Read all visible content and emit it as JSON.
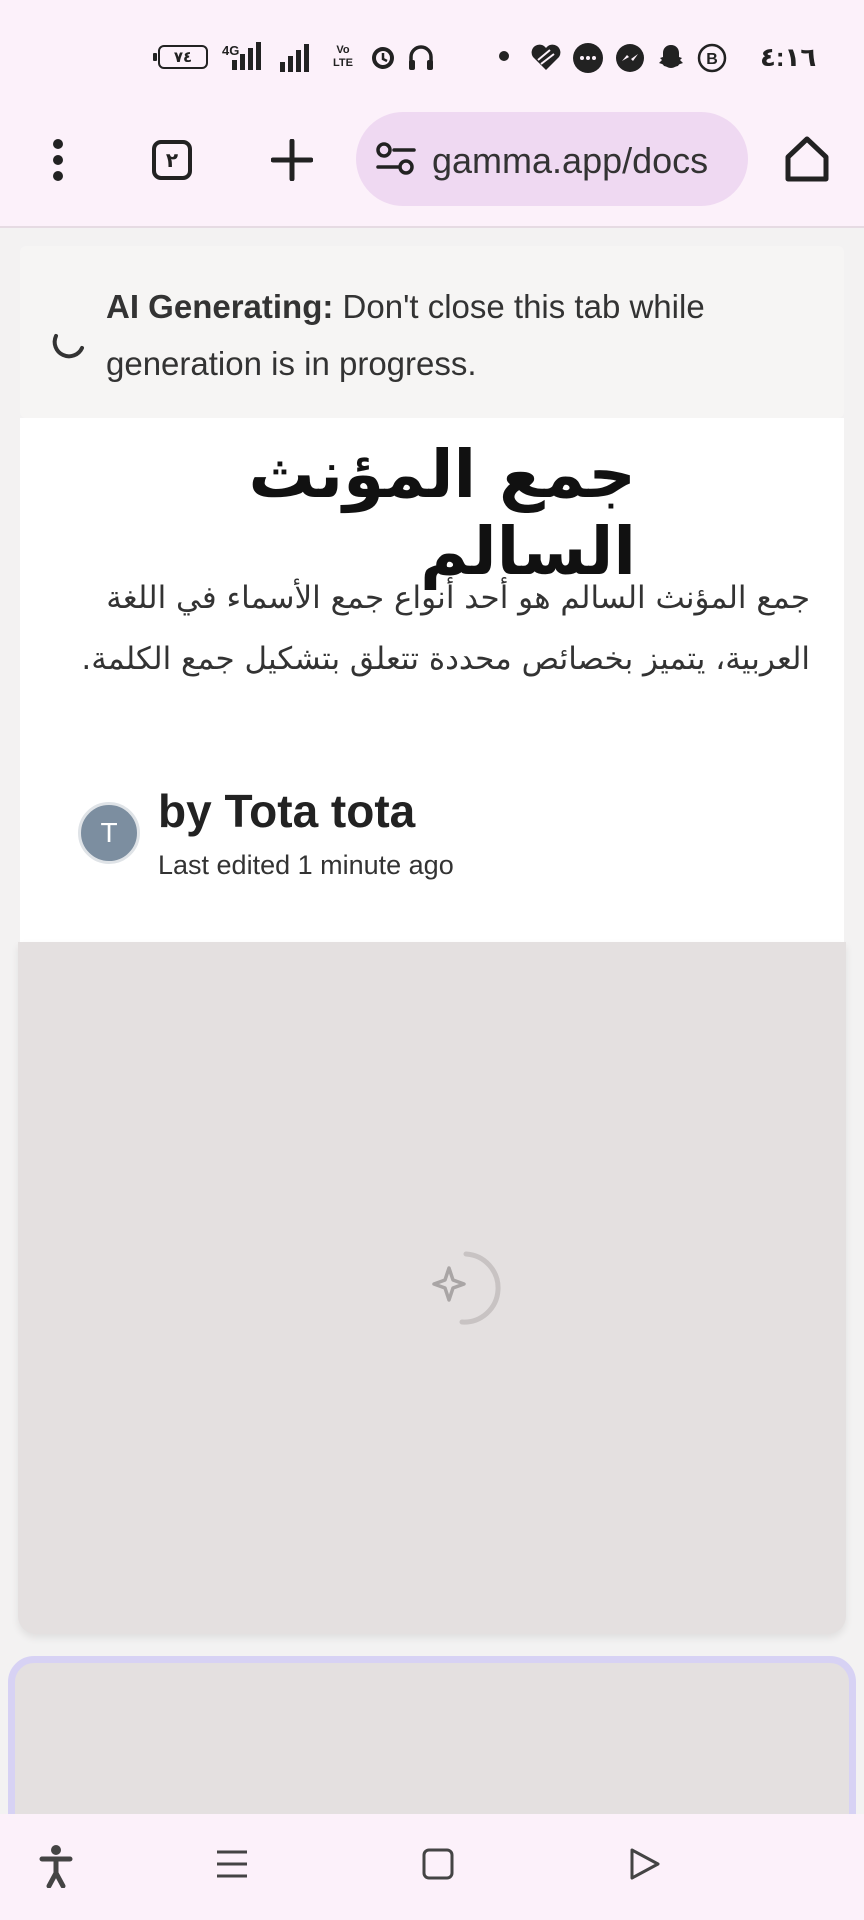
{
  "status_bar": {
    "battery": "٧٤",
    "network": "4G",
    "volte": "Vo LTE",
    "time": "٤:١٦",
    "icons": [
      "battery-icon",
      "signal-icon",
      "signal-icon",
      "volte-icon",
      "alarm-icon",
      "headphones-icon",
      "dot-icon",
      "heart-app-icon",
      "chat-icon",
      "messenger-icon",
      "snapchat-icon",
      "b-app-icon"
    ]
  },
  "toolbar": {
    "tab_count": "٢",
    "url": "gamma.app/docs",
    "icons": [
      "more-vert-icon",
      "tab-switcher-icon",
      "new-tab-icon",
      "site-settings-icon",
      "home-icon"
    ]
  },
  "banner": {
    "label": "AI Generating:",
    "message": " Don't close this tab while generation is in progress."
  },
  "doc": {
    "title": "جمع المؤنث السالم",
    "description": "جمع المؤنث السالم هو أحد أنواع جمع الأسماء في اللغة العربية، يتميز بخصائص محددة تتعلق بتشكيل جمع الكلمة.",
    "avatar_initial": "T",
    "author": "by Tota tota",
    "edited": "Last edited 1 minute ago"
  },
  "navbar": {
    "icons": [
      "accessibility-icon",
      "recent-apps-icon",
      "home-button-icon",
      "back-icon"
    ]
  },
  "colors": {
    "browser_chrome": "#fcf1fa",
    "url_pill": "#efd9f2",
    "placeholder": "#e4e0e0",
    "next_card_border": "#d7d2f4",
    "avatar": "#7c8ea0"
  }
}
